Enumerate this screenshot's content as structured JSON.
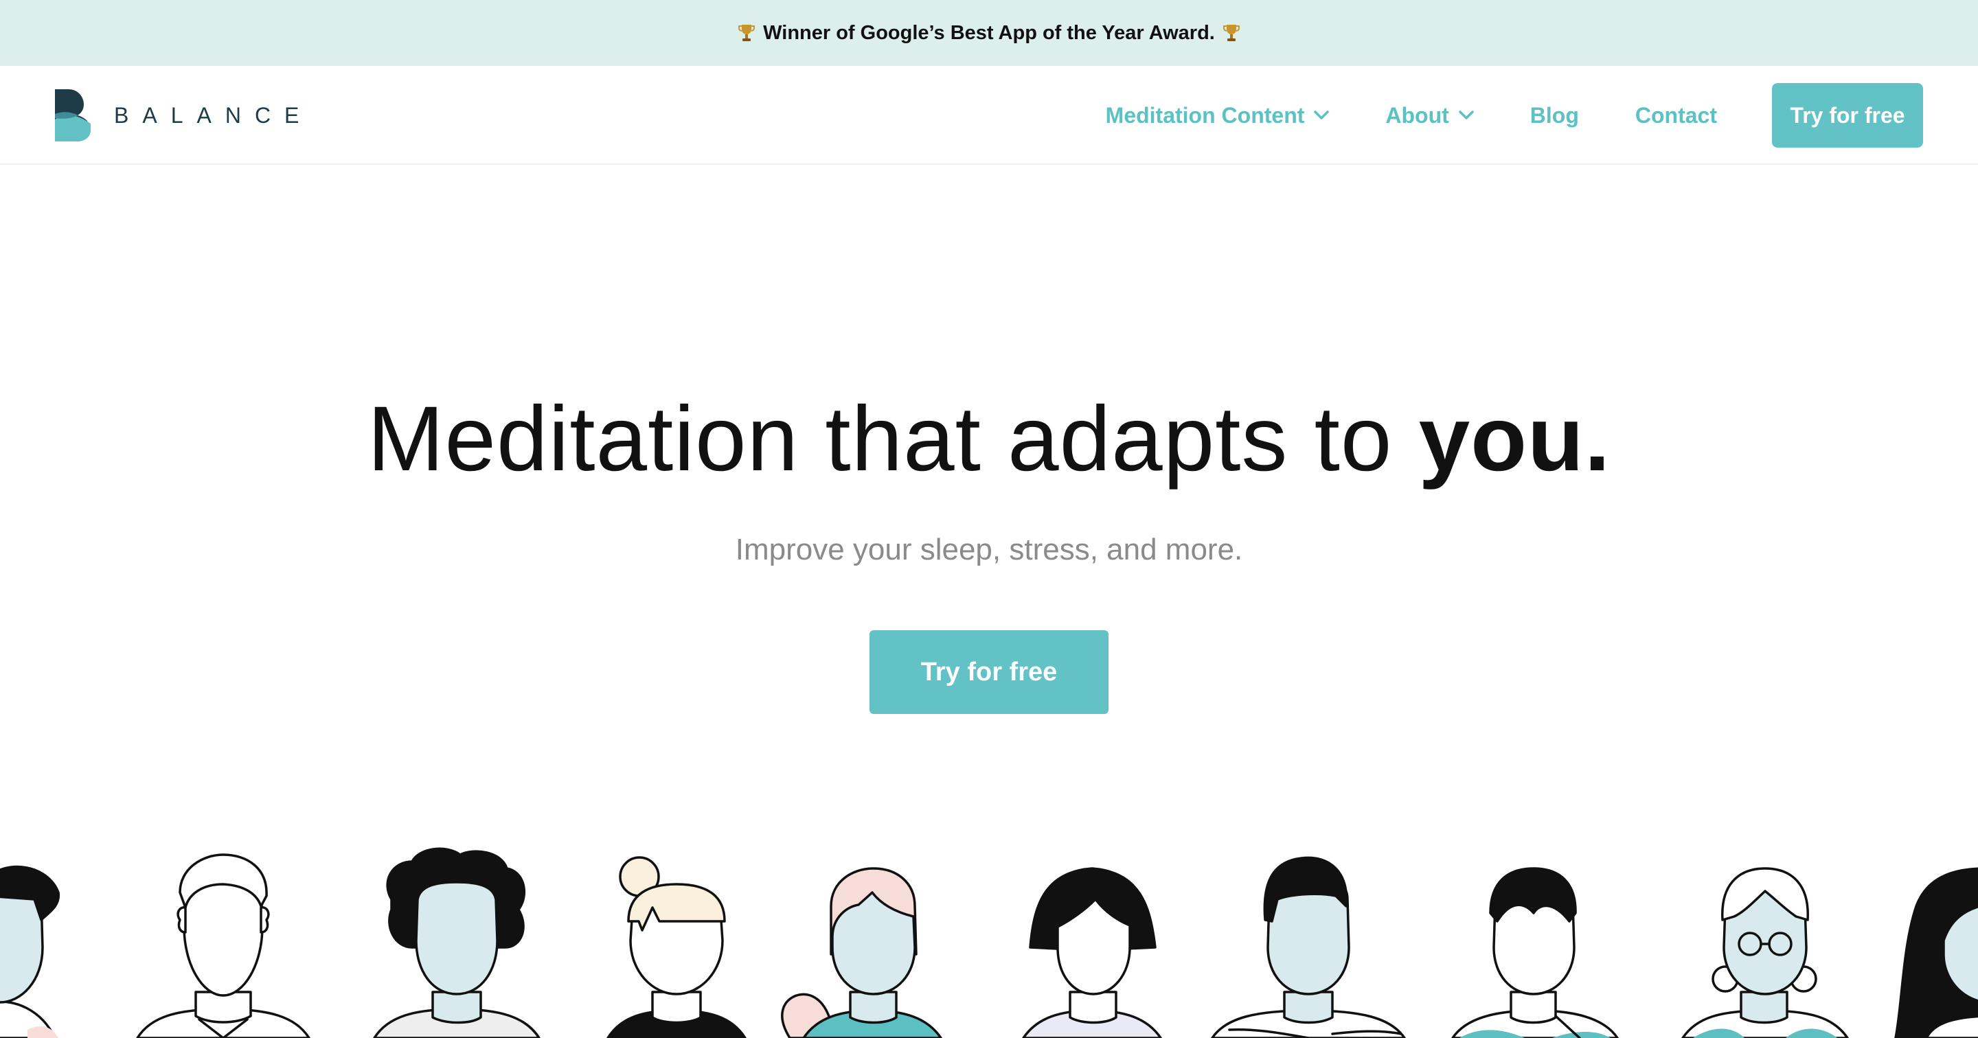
{
  "banner": {
    "text": "Winner of Google’s Best App of the Year Award.",
    "icon": "trophy-icon"
  },
  "header": {
    "logo_text": "BALANCE",
    "nav": [
      {
        "label": "Meditation Content",
        "has_dropdown": true
      },
      {
        "label": "About",
        "has_dropdown": true
      },
      {
        "label": "Blog",
        "has_dropdown": false
      },
      {
        "label": "Contact",
        "has_dropdown": false
      }
    ],
    "cta_label": "Try for free"
  },
  "hero": {
    "title_prefix": "Meditation that adapts to ",
    "title_emphasis": "you.",
    "subtitle": "Improve your sleep, stress, and more.",
    "cta_label": "Try for free"
  },
  "colors": {
    "accent": "#62c2c5",
    "banner_bg": "#dcefea",
    "logo_dark": "#1e3b48",
    "face_blue": "#d8eaee",
    "hair_cream": "#fbf0de",
    "hair_pink": "#f6ddd8"
  }
}
